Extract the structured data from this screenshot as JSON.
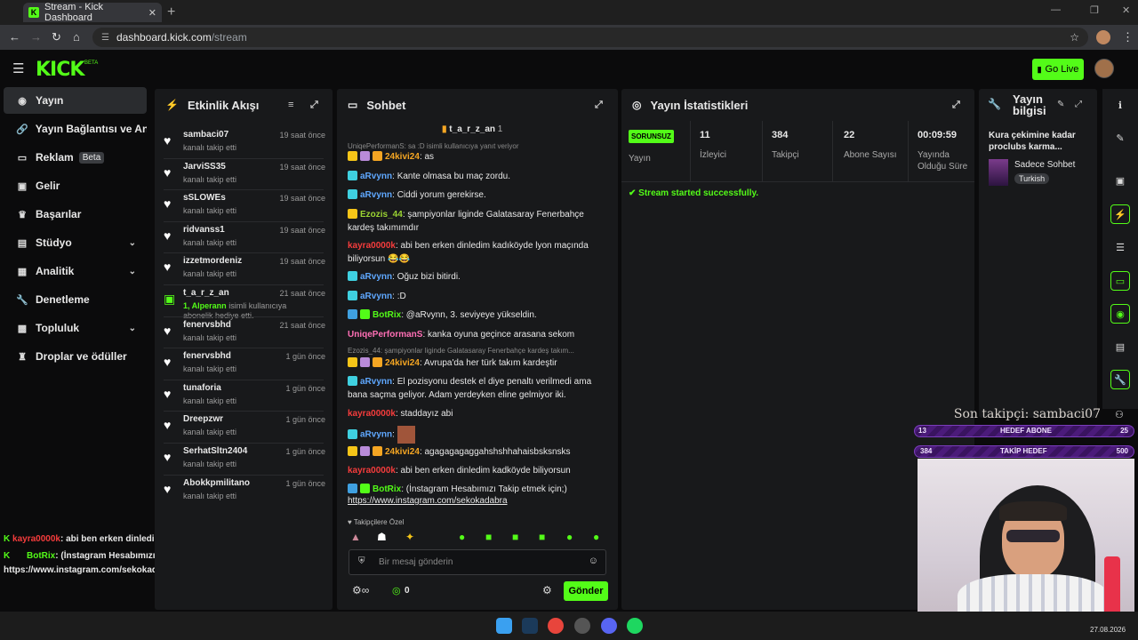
{
  "browser": {
    "tab_title": "Stream - Kick Dashboard",
    "url_host": "dashboard.kick.com",
    "url_path": "/stream"
  },
  "header": {
    "logo": "KICK",
    "logo_badge": "BETA",
    "go_live": "Go Live"
  },
  "sidebar": {
    "items": [
      {
        "label": "Yayın",
        "icon": "broadcast-icon"
      },
      {
        "label": "Yayın Bağlantısı ve Anahtar",
        "icon": "link-icon"
      },
      {
        "label": "Reklam",
        "badge": "Beta",
        "icon": "ad-icon"
      },
      {
        "label": "Gelir",
        "icon": "money-icon"
      },
      {
        "label": "Başarılar",
        "icon": "trophy-icon"
      },
      {
        "label": "Stüdyo",
        "icon": "studio-icon"
      },
      {
        "label": "Analitik",
        "icon": "chart-icon"
      },
      {
        "label": "Denetleme",
        "icon": "wrench-icon"
      },
      {
        "label": "Topluluk",
        "icon": "community-icon"
      },
      {
        "label": "Droplar ve ödüller",
        "icon": "gift-icon"
      }
    ]
  },
  "events": {
    "title": "Etkinlik Akışı",
    "items": [
      {
        "name": "sambaci07",
        "sub": "kanalı takip etti",
        "time": "19 saat önce"
      },
      {
        "name": "JarviSS35",
        "sub": "kanalı takip etti",
        "time": "19 saat önce"
      },
      {
        "name": "sSLOWEs",
        "sub": "kanalı takip etti",
        "time": "19 saat önce"
      },
      {
        "name": "ridvanss1",
        "sub": "kanalı takip etti",
        "time": "19 saat önce"
      },
      {
        "name": "izzetmordeniz",
        "sub": "kanalı takip etti",
        "time": "19 saat önce"
      },
      {
        "name": "t_a_r_z_an",
        "sub_highlight": "1, Alperann",
        "sub": "isimli kullanıcıya abonelik hediye etti.",
        "time": "21 saat önce"
      },
      {
        "name": "fenervsbhd",
        "sub": "kanalı takip etti",
        "time": "21 saat önce"
      },
      {
        "name": "fenervsbhd",
        "sub": "kanalı takip etti",
        "time": "1 gün önce"
      },
      {
        "name": "tunaforia",
        "sub": "kanalı takip etti",
        "time": "1 gün önce"
      },
      {
        "name": "Dreepzwr",
        "sub": "kanalı takip etti",
        "time": "1 gün önce"
      },
      {
        "name": "SerhatSltn2404",
        "sub": "kanalı takip etti",
        "time": "1 gün önce"
      },
      {
        "name": "Abokkpmilitano",
        "sub": "kanalı takip etti",
        "time": "1 gün önce"
      }
    ]
  },
  "chat": {
    "title": "Sohbet",
    "pinned_user": "t_a_r_z_an",
    "pinned_count": "1",
    "reply1": "UniqePerformanS: sa :D isimli kullanıcıya yanıt veriyor",
    "reply2": "Ezozis_44: şampiyonlar liginde Galatasaray Fenerbahçe kardeş takım...",
    "messages": [
      {
        "user": "24kivi24",
        "color": "#f5a623",
        "text": "as"
      },
      {
        "user": "aRvynn",
        "color": "#5fa8ff",
        "text": "Kante olmasa bu maç zordu."
      },
      {
        "user": "aRvynn",
        "color": "#5fa8ff",
        "text": "Ciddi yorum gerekirse."
      },
      {
        "user": "Ezozis_44",
        "color": "#9bd432",
        "text": "şampiyonlar liginde Galatasaray Fenerbahçe kardeş takımımdır"
      },
      {
        "user": "kayra0000k",
        "color": "#f53c3c",
        "text": "abi ben erken dinledim kadıköyde lyon maçında biliyorsun 😂😂"
      },
      {
        "user": "aRvynn",
        "color": "#5fa8ff",
        "text": "Oğuz bizi bitirdi."
      },
      {
        "user": "aRvynn",
        "color": "#5fa8ff",
        "text": ":D"
      },
      {
        "user": "BotRix",
        "color": "#53fc18",
        "text": "@aRvynn, 3. seviyeye yükseldin."
      },
      {
        "user": "UniqePerformanS",
        "color": "#ff6fb5",
        "text": "kanka oyuna geçince arasana sekom"
      },
      {
        "user": "24kivi24",
        "color": "#f5a623",
        "text": "Avrupa'da her türk takım kardeştir"
      },
      {
        "user": "aRvynn",
        "color": "#5fa8ff",
        "text": "El pozisyonu destek el diye penaltı verilmedi ama bana saçma geliyor. Adam yerdeyken eline gelmiyor iki."
      },
      {
        "user": "kayra0000k",
        "color": "#f53c3c",
        "text": "staddayız abi"
      },
      {
        "user": "aRvynn",
        "color": "#5fa8ff",
        "text": ""
      },
      {
        "user": "24kivi24",
        "color": "#f5a623",
        "text": "agagagagaggahshshhahaisbsksnsks"
      },
      {
        "user": "kayra0000k",
        "color": "#f53c3c",
        "text": "abi ben erken dinledim kadköyde biliyorsun"
      },
      {
        "user": "BotRix",
        "color": "#53fc18",
        "text": "(İnstagram Hesabımızı Takip etmek için;)"
      }
    ],
    "link": "https://www.instagram.com/sekokadabra",
    "followers_only": "Takipçilere Özel",
    "input_placeholder": "Bir mesaj gönderin",
    "points": "0",
    "send": "Gönder"
  },
  "stats": {
    "title": "Yayın İstatistikleri",
    "status_badge": "SORUNSUZ",
    "status_label": "Yayın",
    "viewers": "11",
    "viewers_label": "İzleyici",
    "followers": "384",
    "followers_label": "Takipçi",
    "subs": "22",
    "subs_label": "Abone Sayısı",
    "duration": "00:09:59",
    "duration_label": "Yayında Olduğu Süre",
    "log": "Stream started successfully."
  },
  "info": {
    "title": "Yayın bilgisi",
    "stream_title": "Kura çekimine kadar proclubs karma...",
    "category": "Sadece Sohbet",
    "language": "Turkish"
  },
  "overlay": {
    "last_follower": "Son takipçi: sambaci07",
    "sub_goal_left": "13",
    "sub_goal_label": "HEDEF ABONE",
    "sub_goal_right": "25",
    "follow_goal_left": "384",
    "follow_goal_label": "TAKİP HEDEF",
    "follow_goal_right": "500"
  },
  "bottom_chat": {
    "line1_user": "kayra0000k",
    "line1_text": ": abi ben erken dinledim kadköyde biliyorsun",
    "line2_user": "BotRix",
    "line2_text": ": (İnstagram Hesabımızı Takip etmek için;)",
    "line3_text": "https://www.instagram.com/sekokadabra"
  },
  "taskbar": {
    "date": "27.08.2026"
  }
}
